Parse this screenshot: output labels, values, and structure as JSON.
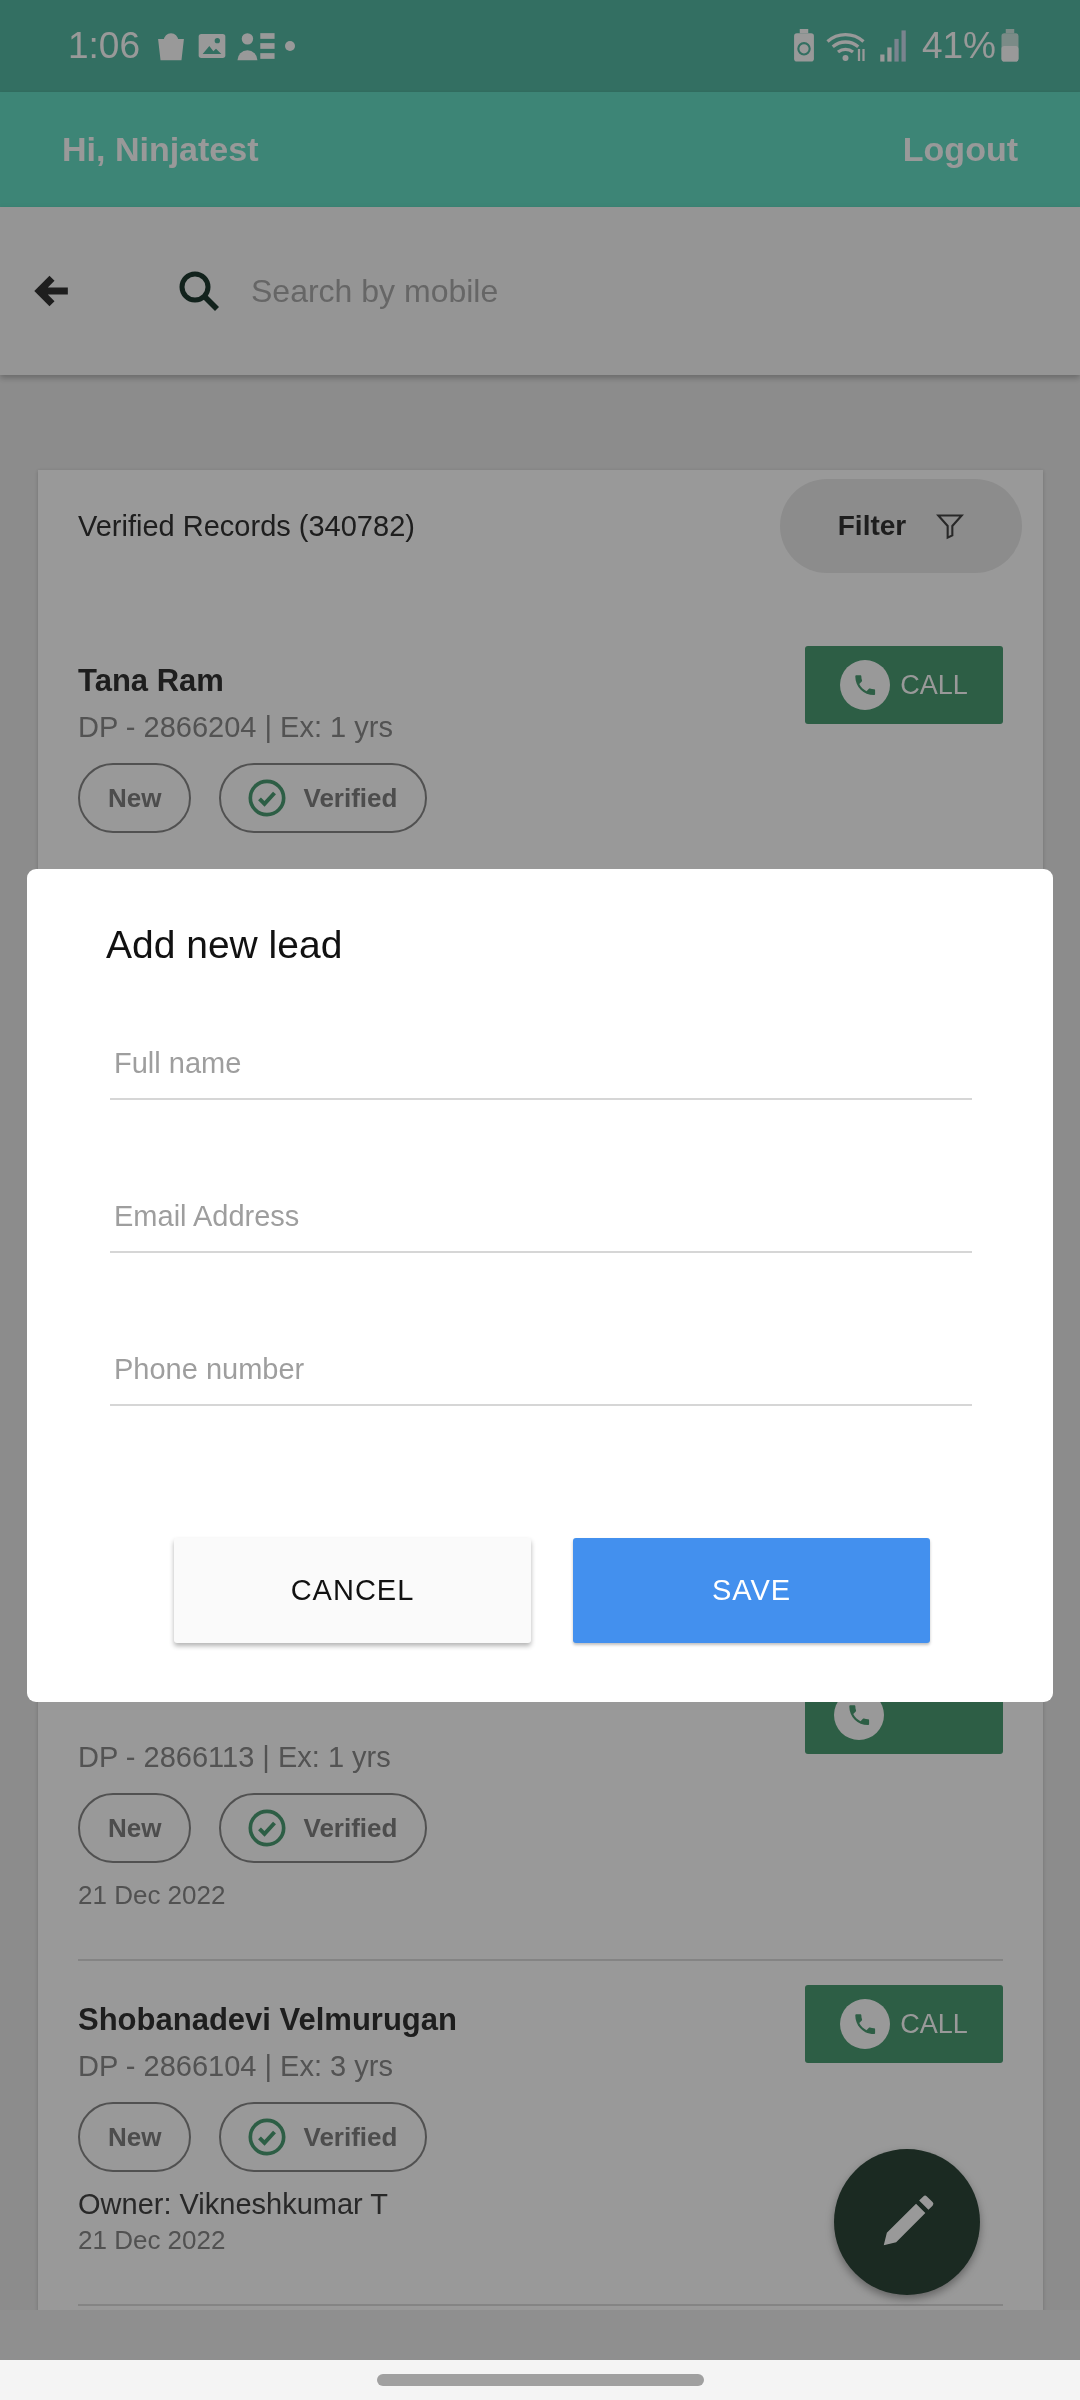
{
  "status_bar": {
    "time": "1:06",
    "battery": "41%"
  },
  "app_bar": {
    "greeting": "Hi, Ninjatest",
    "action": "Logout"
  },
  "search": {
    "placeholder": "Search by mobile"
  },
  "records_card": {
    "title": "Verified Records (340782)",
    "filter": "Filter",
    "records": [
      {
        "name": "Tana Ram",
        "details": "DP - 2866204 | Ex: 1 yrs",
        "tags": [
          {
            "label": "New",
            "kind": "plain"
          },
          {
            "label": "Verified",
            "kind": "verified"
          }
        ],
        "call": "CALL"
      },
      {
        "details": "DP - 2866113 | Ex: 1 yrs",
        "tags": [
          {
            "label": "New",
            "kind": "plain"
          },
          {
            "label": "Verified",
            "kind": "verified"
          }
        ],
        "date": "21 Dec 2022"
      },
      {
        "name": "Shobanadevi Velmurugan",
        "details": "DP - 2866104 | Ex: 3 yrs",
        "tags": [
          {
            "label": "New",
            "kind": "plain"
          },
          {
            "label": "Verified",
            "kind": "verified"
          }
        ],
        "owner": "Owner: Vikneshkumar T",
        "date": "21 Dec 2022",
        "call": "CALL"
      }
    ]
  },
  "dialog": {
    "title": "Add new lead",
    "fields": [
      {
        "placeholder": "Full name"
      },
      {
        "placeholder": "Email Address"
      },
      {
        "placeholder": "Phone number"
      }
    ],
    "buttons": [
      {
        "label": "CANCEL",
        "kind": "secondary"
      },
      {
        "label": "SAVE",
        "kind": "primary"
      }
    ]
  }
}
